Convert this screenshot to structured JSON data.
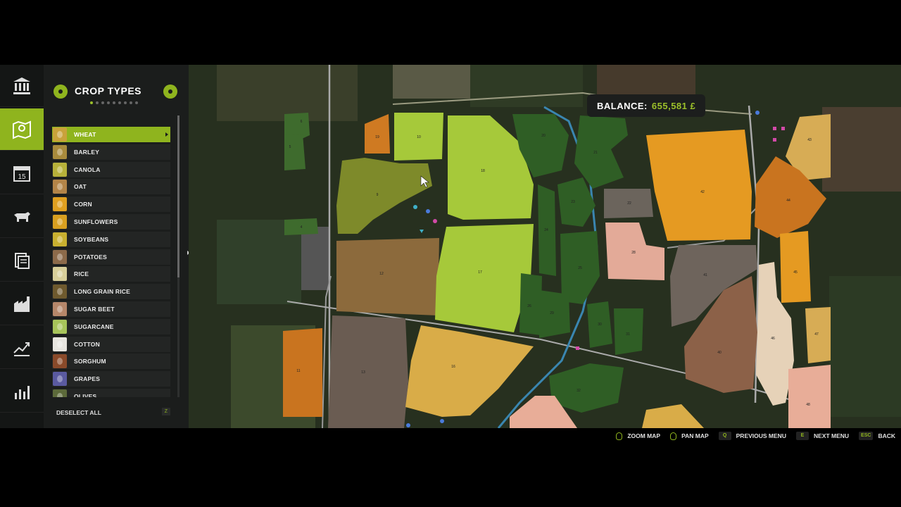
{
  "panel": {
    "title": "CROP TYPES",
    "deselect_label": "DESELECT ALL",
    "deselect_key": "Z"
  },
  "crops": [
    {
      "label": "WHEAT",
      "color": "#c9a23a",
      "selected": true
    },
    {
      "label": "BARLEY",
      "color": "#a98b3c"
    },
    {
      "label": "CANOLA",
      "color": "#b7b13a"
    },
    {
      "label": "OAT",
      "color": "#b38448"
    },
    {
      "label": "CORN",
      "color": "#e0a020"
    },
    {
      "label": "SUNFLOWERS",
      "color": "#d9a020"
    },
    {
      "label": "SOYBEANS",
      "color": "#c9b030"
    },
    {
      "label": "POTATOES",
      "color": "#8c6a4a"
    },
    {
      "label": "RICE",
      "color": "#d8cf9a"
    },
    {
      "label": "LONG GRAIN RICE",
      "color": "#6f5a2e"
    },
    {
      "label": "SUGAR BEET",
      "color": "#b6876a"
    },
    {
      "label": "SUGARCANE",
      "color": "#a7c45a"
    },
    {
      "label": "COTTON",
      "color": "#e8e6e0"
    },
    {
      "label": "SORGHUM",
      "color": "#8a4a2a"
    },
    {
      "label": "GRAPES",
      "color": "#5a5aa0"
    },
    {
      "label": "OLIVES",
      "color": "#5c6a3a"
    }
  ],
  "balance": {
    "label": "BALANCE:",
    "value": "655,581 £"
  },
  "hints": {
    "zoom": "ZOOM MAP",
    "pan": "PAN MAP",
    "prev_key": "Q",
    "prev": "PREVIOUS MENU",
    "next_key": "E",
    "next": "NEXT MENU",
    "back_key": "ESC",
    "back": "BACK"
  },
  "fields": [
    {
      "n": "6"
    },
    {
      "n": "5"
    },
    {
      "n": "4"
    },
    {
      "n": "19"
    },
    {
      "n": "10"
    },
    {
      "n": "18"
    },
    {
      "n": "9"
    },
    {
      "n": "12"
    },
    {
      "n": "17"
    },
    {
      "n": "20"
    },
    {
      "n": "21"
    },
    {
      "n": "22"
    },
    {
      "n": "23"
    },
    {
      "n": "24"
    },
    {
      "n": "25"
    },
    {
      "n": "26"
    },
    {
      "n": "42"
    },
    {
      "n": "43"
    },
    {
      "n": "44"
    },
    {
      "n": "45"
    },
    {
      "n": "41"
    },
    {
      "n": "40"
    },
    {
      "n": "46"
    },
    {
      "n": "47"
    },
    {
      "n": "48"
    },
    {
      "n": "11"
    },
    {
      "n": "13"
    },
    {
      "n": "16"
    },
    {
      "n": "29"
    },
    {
      "n": "30"
    },
    {
      "n": "31"
    },
    {
      "n": "32"
    },
    {
      "n": "28"
    }
  ],
  "colors": {
    "accent": "#8fb41e",
    "panel_bg": "#1b1d1c",
    "rail_bg": "#141615"
  }
}
